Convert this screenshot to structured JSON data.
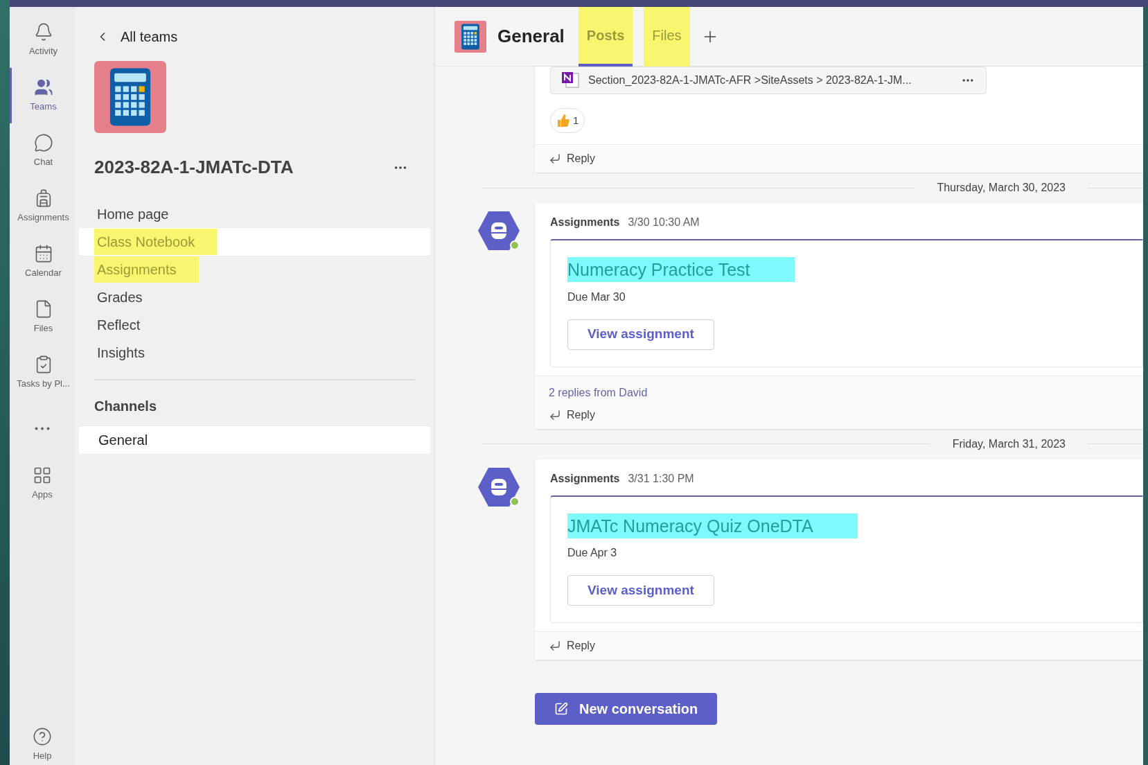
{
  "rail": {
    "items": [
      {
        "label": "Activity",
        "selected": false
      },
      {
        "label": "Teams",
        "selected": true
      },
      {
        "label": "Chat",
        "selected": false
      },
      {
        "label": "Assignments",
        "selected": false
      },
      {
        "label": "Calendar",
        "selected": false
      },
      {
        "label": "Files",
        "selected": false
      },
      {
        "label": "Tasks by Pl...",
        "selected": false
      }
    ],
    "apps": "Apps",
    "help": "Help"
  },
  "sidebar": {
    "back": "All teams",
    "team_name": "2023-82A-1-JMATc-DTA",
    "items": [
      {
        "label": "Home page",
        "selected": false,
        "highlighted": false
      },
      {
        "label": "Class Notebook",
        "selected": true,
        "highlighted": true
      },
      {
        "label": "Assignments",
        "selected": false,
        "highlighted": true
      },
      {
        "label": "Grades",
        "selected": false,
        "highlighted": false
      },
      {
        "label": "Reflect",
        "selected": false,
        "highlighted": false
      },
      {
        "label": "Insights",
        "selected": false,
        "highlighted": false
      }
    ],
    "channels_heading": "Channels",
    "channels": [
      {
        "label": "General",
        "selected": true
      }
    ]
  },
  "header": {
    "title": "General",
    "tabs": [
      {
        "label": "Posts",
        "selected": true,
        "highlighted": true
      },
      {
        "label": "Files",
        "selected": false,
        "highlighted": true
      }
    ]
  },
  "posts": [
    {
      "kind": "attachment",
      "path": "Section_2023-82A-1-JMATc-AFR >SiteAssets > 2023-82A-1-JM...",
      "reaction_count": "1",
      "reply": "Reply"
    },
    {
      "kind": "assignment",
      "date": "Thursday, March 30, 2023",
      "author": "Assignments",
      "time": "3/30 10:30 AM",
      "title": "Numeracy Practice Test",
      "highlighted": true,
      "due": "Due Mar 30",
      "button": "View assignment",
      "replies": "2 replies from David",
      "reply": "Reply"
    },
    {
      "kind": "assignment",
      "date": "Friday, March 31, 2023",
      "author": "Assignments",
      "time": "3/31 1:30 PM",
      "title": "JMATc Numeracy Quiz OneDTA",
      "highlighted": true,
      "due": "Due Apr 3",
      "button": "View assignment",
      "reply": "Reply"
    }
  ],
  "new_conversation": "New conversation"
}
